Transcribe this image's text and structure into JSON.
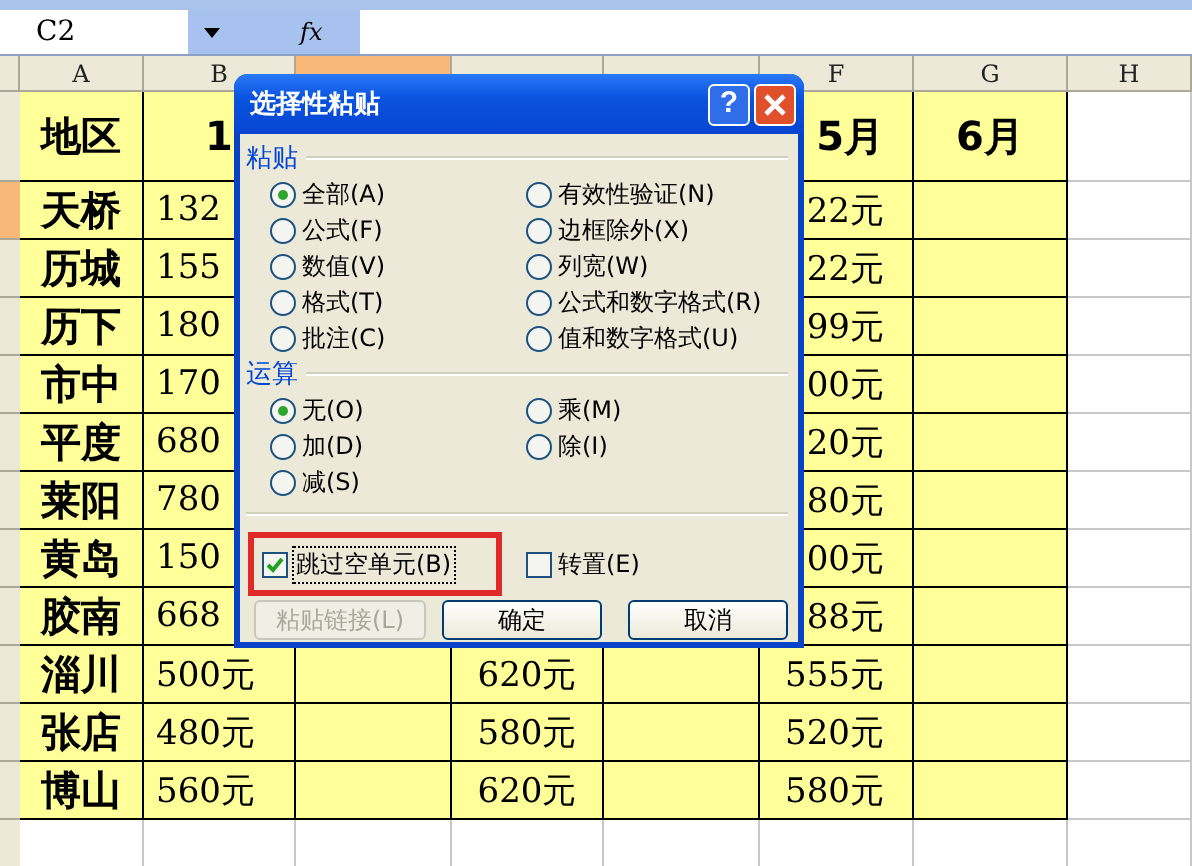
{
  "formula_bar": {
    "name_box": "C2",
    "fx": "fx"
  },
  "columns": [
    {
      "label": "A",
      "selected": false
    },
    {
      "label": "B",
      "selected": false
    },
    {
      "selected": true
    },
    {
      "selected": false
    },
    {
      "selected": false
    },
    {
      "label": "F",
      "selected": false
    },
    {
      "label": "G",
      "selected": false
    },
    {
      "label": "H",
      "selected": false
    }
  ],
  "rows": [
    {
      "selected": false,
      "cells": [
        "地区",
        "1",
        null,
        null,
        null,
        "5月",
        "6月"
      ]
    },
    {
      "selected": true,
      "cells": [
        "天桥",
        "132",
        null,
        null,
        null,
        "22元",
        null
      ]
    },
    {
      "selected": false,
      "cells": [
        "历城",
        "155",
        null,
        null,
        null,
        "22元",
        null
      ]
    },
    {
      "selected": false,
      "cells": [
        "历下",
        "180",
        null,
        null,
        null,
        "99元",
        null
      ]
    },
    {
      "selected": false,
      "cells": [
        "市中",
        "170",
        null,
        null,
        null,
        "00元",
        null
      ]
    },
    {
      "selected": false,
      "cells": [
        "平度",
        "680",
        null,
        null,
        null,
        "20元",
        null
      ]
    },
    {
      "selected": false,
      "cells": [
        "莱阳",
        "780",
        null,
        null,
        null,
        "80元",
        null
      ]
    },
    {
      "selected": false,
      "cells": [
        "黄岛",
        "150",
        null,
        null,
        null,
        "00元",
        null
      ]
    },
    {
      "selected": false,
      "cells": [
        "胶南",
        "668",
        null,
        null,
        null,
        "88元",
        null
      ]
    },
    {
      "selected": false,
      "cells": [
        "淄川",
        "500元",
        null,
        "620元",
        null,
        "555元",
        null
      ]
    },
    {
      "selected": false,
      "cells": [
        "张店",
        "480元",
        null,
        "580元",
        null,
        "520元",
        null
      ]
    },
    {
      "selected": false,
      "cells": [
        "博山",
        "560元",
        null,
        "620元",
        null,
        "580元",
        null
      ]
    },
    {
      "selected": false,
      "cells": [
        null,
        null,
        null,
        null,
        null,
        null,
        null
      ]
    }
  ],
  "dialog": {
    "title": "选择性粘贴",
    "help": "?",
    "paste_label": "粘贴",
    "paste_options": [
      {
        "label": "全部(A)",
        "selected": true
      },
      {
        "label": "有效性验证(N)",
        "selected": false
      },
      {
        "label": "公式(F)",
        "selected": false
      },
      {
        "label": "边框除外(X)",
        "selected": false
      },
      {
        "label": "数值(V)",
        "selected": false
      },
      {
        "label": "列宽(W)",
        "selected": false
      },
      {
        "label": "格式(T)",
        "selected": false
      },
      {
        "label": "公式和数字格式(R)",
        "selected": false
      },
      {
        "label": "批注(C)",
        "selected": false
      },
      {
        "label": "值和数字格式(U)",
        "selected": false
      }
    ],
    "operation_label": "运算",
    "operation_options": [
      {
        "label": "无(O)",
        "selected": true
      },
      {
        "label": "乘(M)",
        "selected": false
      },
      {
        "label": "加(D)",
        "selected": false
      },
      {
        "label": "除(I)",
        "selected": false
      },
      {
        "label": "减(S)",
        "selected": false
      }
    ],
    "checkboxes": [
      {
        "label": "跳过空单元(B)",
        "checked": true,
        "highlighted": true
      },
      {
        "label": "转置(E)",
        "checked": false,
        "highlighted": false
      }
    ],
    "buttons": [
      {
        "label": "粘贴链接(L)",
        "disabled": true
      },
      {
        "label": "确定",
        "disabled": false
      },
      {
        "label": "取消",
        "disabled": false
      }
    ]
  }
}
